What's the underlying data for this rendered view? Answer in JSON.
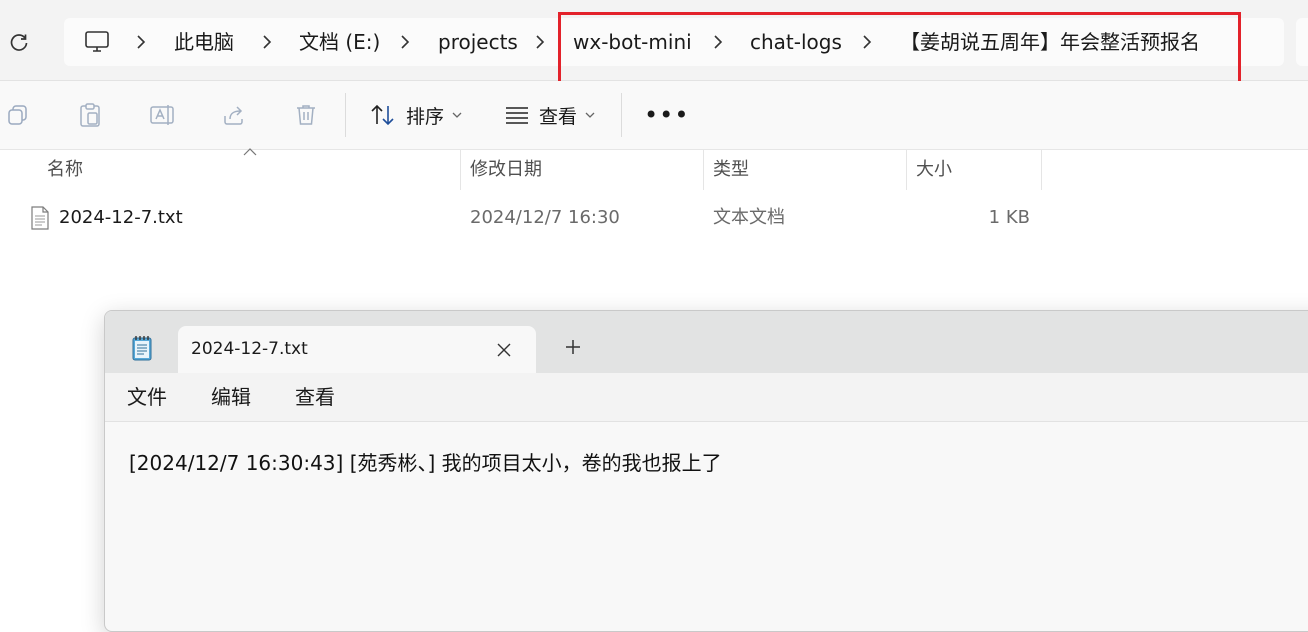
{
  "explorer": {
    "breadcrumbs": [
      {
        "label": "此电脑"
      },
      {
        "label": "文档 (E:)"
      },
      {
        "label": "projects"
      },
      {
        "label": "wx-bot-mini"
      },
      {
        "label": "chat-logs"
      },
      {
        "label": "【姜胡说五周年】年会整活预报名"
      }
    ],
    "highlight_color": "#e3222b",
    "toolbar": {
      "icons": [
        "copy-icon",
        "paste-icon",
        "rename-icon",
        "share-icon",
        "delete-icon"
      ],
      "sort_label": "排序",
      "view_label": "查看",
      "more_label": "•••"
    },
    "columns": {
      "name": "名称",
      "modified": "修改日期",
      "type": "类型",
      "size": "大小"
    },
    "files": [
      {
        "name": "2024-12-7.txt",
        "modified": "2024/12/7 16:30",
        "type": "文本文档",
        "size": "1 KB",
        "icon": "text-file-icon"
      }
    ]
  },
  "notepad": {
    "tab_title": "2024-12-7.txt",
    "menu": {
      "file": "文件",
      "edit": "编辑",
      "view": "查看"
    },
    "content": "[2024/12/7 16:30:43] [苑秀彬、] 我的项目太小，卷的我也报上了"
  }
}
